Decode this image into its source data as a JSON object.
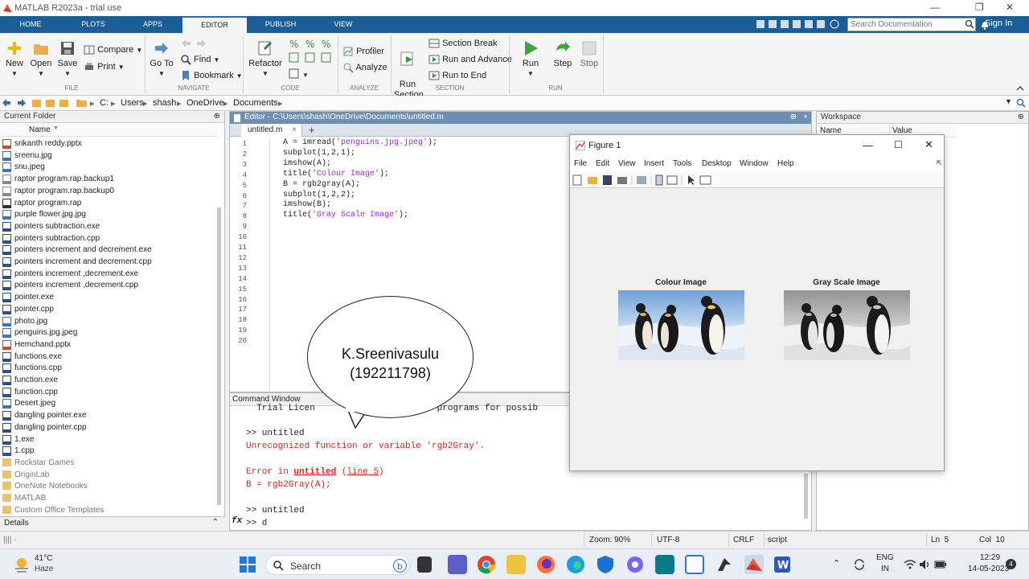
{
  "app": {
    "title": "MATLAB R2023a - trial use"
  },
  "tabs": [
    "HOME",
    "PLOTS",
    "APPS",
    "EDITOR",
    "PUBLISH",
    "VIEW"
  ],
  "active_tab": "EDITOR",
  "search": {
    "placeholder": "Search Documentation"
  },
  "signin": "Sign In",
  "ribbon": {
    "file": {
      "new": "New",
      "open": "Open",
      "save": "Save",
      "compare": "Compare",
      "print": "Print",
      "section": "FILE"
    },
    "navigate": {
      "goto": "Go To",
      "find": "Find",
      "bookmark": "Bookmark",
      "section": "NAVIGATE"
    },
    "code": {
      "refactor": "Refactor",
      "section": "CODE"
    },
    "analyze": {
      "profiler": "Profiler",
      "analyze": "Analyze",
      "section": "ANALYZE"
    },
    "section_grp": {
      "run_section": "Run\nSection",
      "section_break": "Section Break",
      "run_advance": "Run and Advance",
      "run_end": "Run to End",
      "section": "SECTION"
    },
    "run": {
      "run": "Run",
      "step": "Step",
      "stop": "Stop",
      "section": "RUN"
    }
  },
  "address": [
    "C:",
    "Users",
    "shash",
    "OneDrive",
    "Documents"
  ],
  "current_folder": {
    "title": "Current Folder",
    "col_name": "Name",
    "files": [
      "srikanth reddy.pptx",
      "sreenu.jpg",
      "snu.jpeg",
      "raptor program.rap.backup1",
      "raptor program.rap.backup0",
      "raptor program.rap",
      "purple flower.jpg.jpg",
      "pointers subtraction.exe",
      "pointers subtraction.cpp",
      "pointers increment and decrement.exe",
      "pointers increment and decrement.cpp",
      "pointers increment ,decrement.exe",
      "pointers increment ,decrement.cpp",
      "pointer.exe",
      "pointer.cpp",
      "photo.jpg",
      "penguins.jpg.jpeg",
      "Hemchand.pptx",
      "functions.exe",
      "functions.cpp",
      "function.exe",
      "function.cpp",
      "Desert.jpeg",
      "dangling pointer.exe",
      "dangling pointer.cpp",
      "1.exe",
      "1.cpp"
    ],
    "folders": [
      "Rockstar Games",
      "OriginLab",
      "OneNote Notebooks",
      "MATLAB",
      "Custom Office Templates"
    ]
  },
  "details": "Details",
  "editor": {
    "header": "Editor - C:\\Users\\shash\\OneDrive\\Documents\\untitled.m",
    "tab": "untitled.m",
    "lines": [
      "A = imread('penguins.jpg.jpeg');",
      "subplot(1,2,1);",
      "imshow(A);",
      "title('Colour Image');",
      "B = rgb2gray(A);",
      "subplot(1,2,2);",
      "imshow(B);",
      "title('Gray Scale Image');"
    ],
    "line_count": 20
  },
  "command_window": {
    "title": "Command Window",
    "lines": [
      {
        "text": "  Trial Licen                       programs for possib",
        "kind": "normal"
      },
      {
        "text": ">> untitled",
        "kind": "normal"
      },
      {
        "text": "Unrecognized function or variable 'rgb2Gray'.",
        "kind": "error"
      },
      {
        "text": "Error in untitled (line 5)",
        "kind": "error"
      },
      {
        "text": "B = rgb2Gray(A);",
        "kind": "error"
      },
      {
        "text": ">> untitled",
        "kind": "normal"
      },
      {
        "text": ">> d",
        "kind": "normal"
      }
    ],
    "prompt_symbol": "fx"
  },
  "workspace": {
    "title": "Workspace",
    "col_name": "Name",
    "col_value": "Value"
  },
  "figure": {
    "title": "Figure 1",
    "menu": [
      "File",
      "Edit",
      "View",
      "Insert",
      "Tools",
      "Desktop",
      "Window",
      "Help"
    ],
    "axes": [
      {
        "title": "Colour Image"
      },
      {
        "title": "Gray Scale Image"
      }
    ]
  },
  "annotation": {
    "name": "K.Sreenivasulu",
    "id": "(192211798)"
  },
  "statusbar": {
    "zoom": "Zoom: 90%",
    "encoding": "UTF-8",
    "eol": "CRLF",
    "type": "script",
    "ln": "Ln  5",
    "col": "Col  10"
  },
  "taskbar": {
    "weather_temp": "41°C",
    "weather_desc": "Haze",
    "search": "Search",
    "lang": "ENG",
    "region": "IN",
    "time": "12:29",
    "date": "14-05-2023",
    "notif": "4"
  },
  "colors": {
    "tabbar": "#1b5d95",
    "editor_header": "#6e8fb3",
    "error": "#e02020",
    "string": "#a020f0"
  }
}
